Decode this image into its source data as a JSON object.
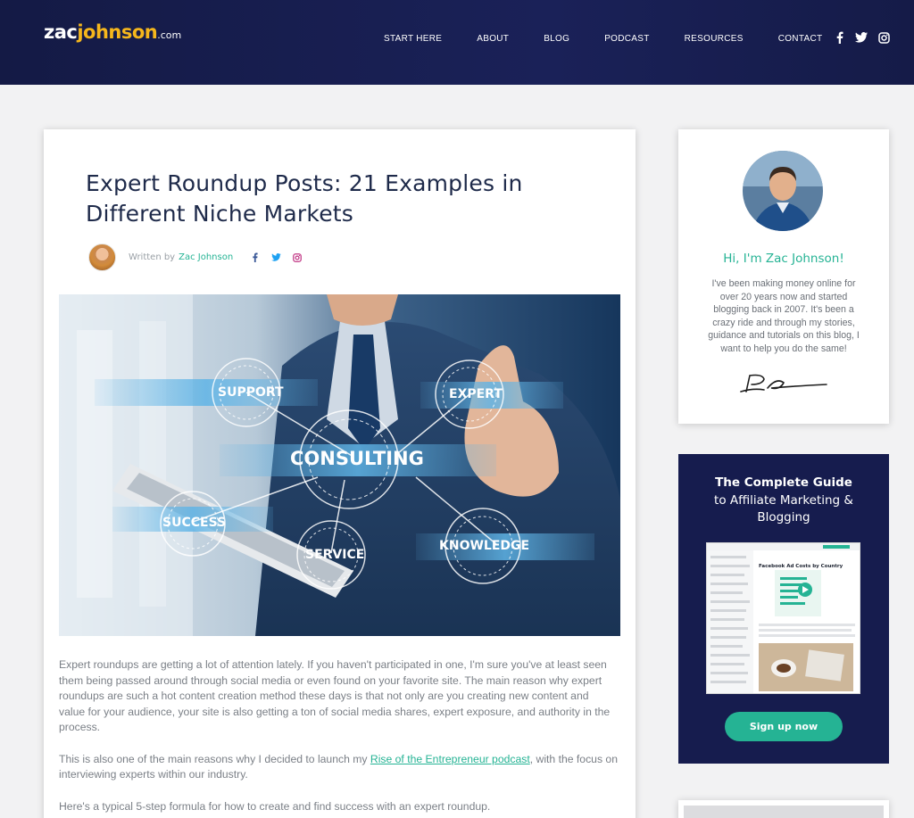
{
  "header": {
    "logo": {
      "part1": "zac",
      "part2": "johnson",
      "part3": ".com"
    },
    "nav": [
      "START HERE",
      "ABOUT",
      "BLOG",
      "PODCAST",
      "RESOURCES",
      "CONTACT"
    ],
    "social_icons": [
      "facebook-icon",
      "twitter-icon",
      "instagram-icon"
    ],
    "colors": {
      "bar": "#161c4e",
      "logo_accent": "#f6b71c"
    }
  },
  "post": {
    "title": "Expert Roundup Posts: 21 Examples in Different Niche Markets",
    "written_by": "Written by",
    "author": "Zac Johnson",
    "author_social": [
      "facebook-icon",
      "twitter-icon",
      "instagram-icon"
    ],
    "hero_labels": {
      "support": "SUPPORT",
      "expert": "EXPERT",
      "consulting": "CONSULTING",
      "success": "SUCCESS",
      "service": "SERVICE",
      "knowledge": "KNOWLEDGE"
    },
    "paragraph1": "Expert roundups are getting a lot of attention lately. If you haven't participated in one, I'm sure you've at least seen them being passed around through social media or even found on your favorite site. The main reason why expert roundups are such a hot content creation method these days is that not only are you creating new content and value for your audience, your site is also getting a ton of social media shares, expert exposure, and authority in the process.",
    "paragraph2_before": "This is also one of the main reasons why I decided to launch my ",
    "paragraph2_link": "Rise of the Entrepreneur podcast",
    "paragraph2_after": ", with the focus on interviewing experts within our industry.",
    "paragraph3": "Here's a typical 5-step formula for how to create and find success with an expert roundup."
  },
  "sidebar": {
    "greeting": "Hi, I'm Zac Johnson!",
    "bio": "I've been making money online for over 20 years now and started blogging back in 2007. It's been a crazy ride and through my stories, guidance and tutorials on this blog, I want to help you do the same!",
    "guide_title": "The Complete Guide",
    "guide_subtitle": "to Affiliate Marketing & Blogging",
    "guide_screenshot_heading": "Facebook Ad Costs by Country",
    "signup_label": "Sign up now"
  },
  "colors": {
    "accent": "#25b394",
    "guide_bg": "#161c4e"
  }
}
